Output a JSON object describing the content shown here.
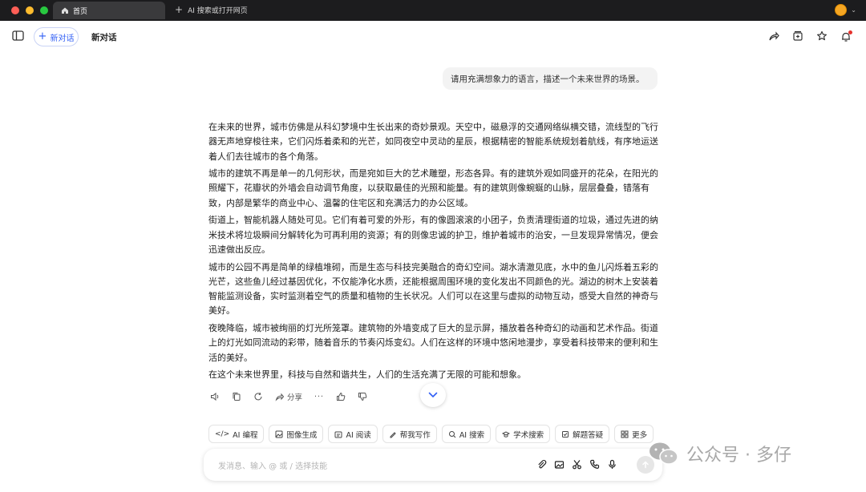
{
  "browser": {
    "tab_home_label": "首页",
    "tab_new_label": "AI 搜索或打开网页"
  },
  "header": {
    "new_chat_label": "新对话",
    "chat_title": "新对话"
  },
  "conversation": {
    "user_message": "请用充满想象力的语言，描述一个未来世界的场景。",
    "answer_paragraphs": [
      "在未来的世界，城市仿佛是从科幻梦境中生长出来的奇妙景观。天空中，磁悬浮的交通网络纵横交错，流线型的飞行器无声地穿梭往来，它们闪烁着柔和的光芒，如同夜空中灵动的星辰，根据精密的智能系统规划着航线，有序地运送着人们去往城市的各个角落。",
      "城市的建筑不再是单一的几何形状，而是宛如巨大的艺术雕塑，形态各异。有的建筑外观如同盛开的花朵，在阳光的照耀下，花瓣状的外墙会自动调节角度，以获取最佳的光照和能量。有的建筑则像蜿蜒的山脉，层层叠叠，错落有致，内部是繁华的商业中心、温馨的住宅区和充满活力的办公区域。",
      "街道上，智能机器人随处可见。它们有着可爱的外形，有的像圆滚滚的小团子，负责清理街道的垃圾，通过先进的纳米技术将垃圾瞬间分解转化为可再利用的资源；有的则像忠诚的护卫，维护着城市的治安，一旦发现异常情况，便会迅速做出反应。",
      "城市的公园不再是简单的绿植堆砌，而是生态与科技完美融合的奇幻空间。湖水清澈见底，水中的鱼儿闪烁着五彩的光芒，这些鱼儿经过基因优化，不仅能净化水质，还能根据周围环境的变化发出不同颜色的光。湖边的树木上安装着智能监测设备，实时监测着空气的质量和植物的生长状况。人们可以在这里与虚拟的动物互动，感受大自然的神奇与美好。",
      "夜晚降临，城市被绚丽的灯光所笼罩。建筑物的外墙变成了巨大的显示屏，播放着各种奇幻的动画和艺术作品。街道上的灯光如同流动的彩带，随着音乐的节奏闪烁变幻。人们在这样的环境中悠闲地漫步，享受着科技带来的便利和生活的美好。",
      "在这个未来世界里，科技与自然和谐共生，人们的生活充满了无限的可能和想象。"
    ],
    "share_label": "分享"
  },
  "tools": [
    {
      "label": "AI 编程",
      "icon": "code-icon"
    },
    {
      "label": "图像生成",
      "icon": "image-icon"
    },
    {
      "label": "AI 阅读",
      "icon": "read-icon"
    },
    {
      "label": "帮我写作",
      "icon": "pen-icon"
    },
    {
      "label": "AI 搜索",
      "icon": "search-icon"
    },
    {
      "label": "学术搜索",
      "icon": "academic-icon"
    },
    {
      "label": "解题答疑",
      "icon": "solve-icon"
    },
    {
      "label": "更多",
      "icon": "grid-icon"
    }
  ],
  "input": {
    "placeholder": "发消息、输入 @ 或 / 选择技能"
  },
  "watermark": {
    "text": "公众号 · 多仔"
  },
  "colors": {
    "accent": "#2f5ef5",
    "titlebar": "#1c1c1e",
    "notify": "#e5322d"
  }
}
